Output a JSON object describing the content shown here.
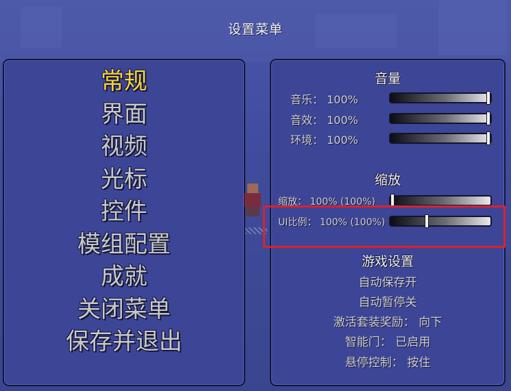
{
  "title": "设置菜单",
  "menu": {
    "items": [
      {
        "label": "常规",
        "active": true
      },
      {
        "label": "界面",
        "active": false
      },
      {
        "label": "视频",
        "active": false
      },
      {
        "label": "光标",
        "active": false
      },
      {
        "label": "控件",
        "active": false
      },
      {
        "label": "模组配置",
        "active": false
      },
      {
        "label": "成就",
        "active": false
      },
      {
        "label": "关闭菜单",
        "active": false
      },
      {
        "label": "保存并退出",
        "active": false
      }
    ]
  },
  "volume": {
    "heading": "音量",
    "rows": [
      {
        "label": "音乐： 100%",
        "value": 1.0
      },
      {
        "label": "音效： 100%",
        "value": 1.0
      },
      {
        "label": "环境： 100%",
        "value": 1.0
      }
    ]
  },
  "zoom": {
    "heading": "缩放",
    "rows": [
      {
        "label": "缩放： 100% (100%)",
        "value": 0.0
      },
      {
        "label": "UI比例： 100% (100%)",
        "value": 0.36
      }
    ]
  },
  "game": {
    "heading": "游戏设置",
    "items": [
      "自动保存开",
      "自动暂停关",
      "激活套装奖励： 向下",
      "智能门： 已启用",
      "悬停控制： 按住"
    ]
  },
  "colors": {
    "active": "#f6d53a",
    "inactive": "#c9c9c9",
    "panel": "#3d4596",
    "highlight": "#e0202a"
  }
}
